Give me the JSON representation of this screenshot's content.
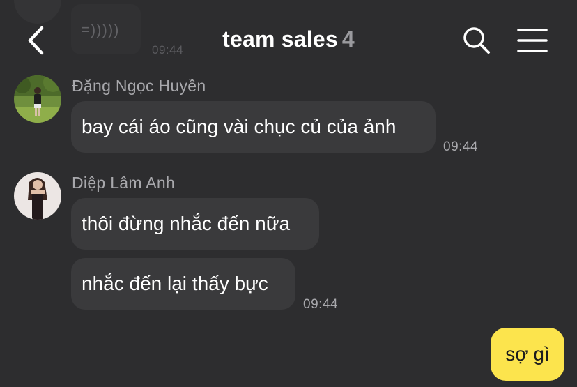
{
  "previous": {
    "bubble_text": "=)))))",
    "time": "09:44"
  },
  "header": {
    "title": "team sales",
    "member_count": "4"
  },
  "groups": [
    {
      "sender": "Đặng Ngọc Huyền",
      "messages": [
        "bay cái áo cũng vài chục củ của ảnh"
      ],
      "time": "09:44"
    },
    {
      "sender": "Diệp Lâm Anh",
      "messages": [
        "thôi đừng nhắc đến nữa",
        "nhắc đến lại thấy bực"
      ],
      "time": "09:44"
    }
  ],
  "mine": {
    "text": "sợ gì"
  },
  "colors": {
    "background": "#2d2d2f",
    "bubble_other": "#3a3a3c",
    "bubble_mine": "#fce44d",
    "meta_text": "#a8a8ac"
  },
  "icons": {
    "back": "chevron-left-icon",
    "search": "search-icon",
    "menu": "hamburger-menu-icon"
  }
}
